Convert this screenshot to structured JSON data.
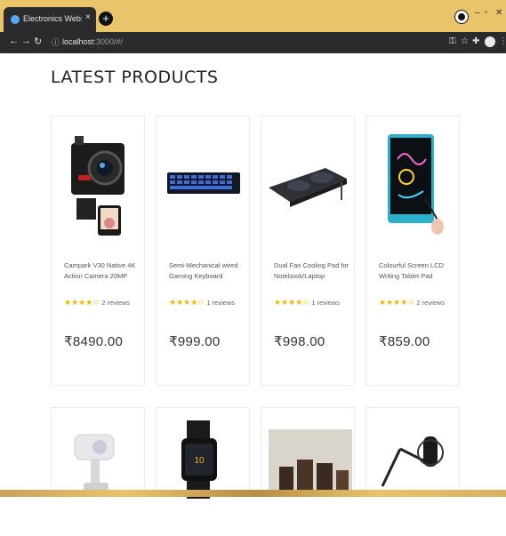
{
  "browser": {
    "tab_title": "Electronics Websites",
    "url": "localhost",
    "url_suffix": ":3000/#/",
    "new_tab": "+",
    "tab_close": "×"
  },
  "page": {
    "heading": "LATEST PRODUCTS"
  },
  "products": [
    {
      "name": "Campark V30 Native 4K Action Camera 20MP",
      "stars": "★★★★☆",
      "reviews": "2 reviews",
      "price": "₹8490.00",
      "image": "action-camera"
    },
    {
      "name": "Semi-Mechanical wired Gaming Keyboard",
      "stars": "★★★★☆",
      "reviews": "1 reviews",
      "price": "₹999.00",
      "image": "keyboard"
    },
    {
      "name": "Dual Fan Cooling Pad for Notebook/Laptop",
      "stars": "★★★★☆",
      "reviews": "1 reviews",
      "price": "₹998.00",
      "image": "cooling-pad"
    },
    {
      "name": "Colourful Screen LCD Writing Tablet Pad",
      "stars": "★★★★☆",
      "reviews": "2 reviews",
      "price": "₹859.00",
      "image": "writing-tablet"
    }
  ],
  "second_row": [
    {
      "image": "webcam"
    },
    {
      "image": "smartwatch"
    },
    {
      "image": "speakers"
    },
    {
      "image": "microphone-arm"
    }
  ],
  "colors": {
    "titlebar": "#e9c46a",
    "toolbar": "#2b2b2e",
    "star": "#f2b705"
  }
}
